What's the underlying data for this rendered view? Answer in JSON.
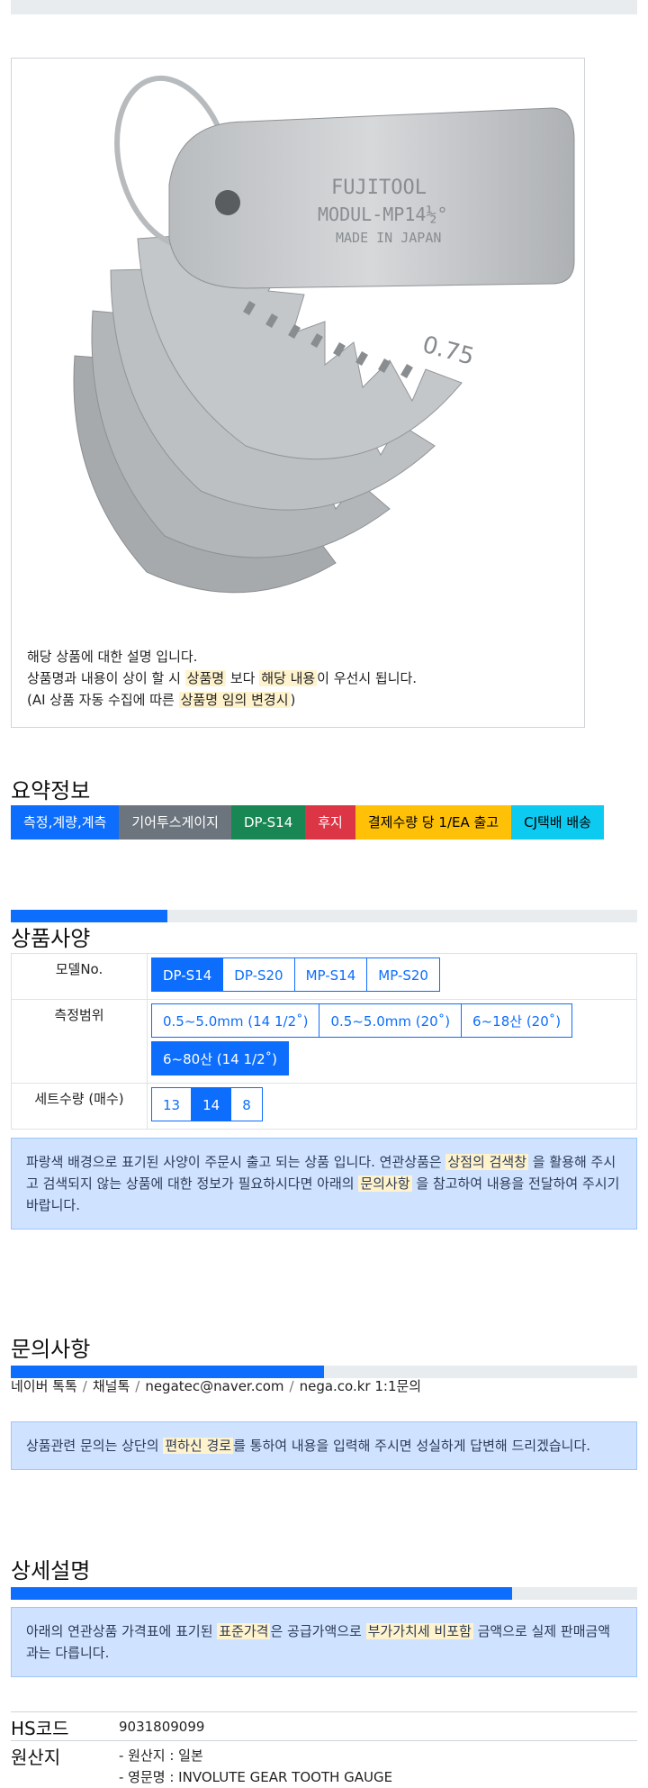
{
  "product": {
    "image_alt": "gear tooth gauge",
    "brand_mark": "FUJITOOL",
    "model_mark": "MODUL-MP14½°",
    "origin_mark": "MADE IN JAPAN",
    "leaf_mark": "0.75",
    "desc_line1": "해당 상품에 대한 설명 입니다.",
    "desc_line2_a": "상품명과 내용이 상이 할 시 ",
    "desc_line2_h1": "상품명",
    "desc_line2_b": " 보다 ",
    "desc_line2_h2": "해당 내용",
    "desc_line2_c": "이 우선시 됩니다.",
    "desc_line3_a": "(AI 상품 자동 수집에 따른 ",
    "desc_line3_h": "상품명 임의 변경시",
    "desc_line3_b": ")"
  },
  "summary": {
    "title": "요약정보",
    "badges": [
      {
        "label": "측정,계량,계측",
        "color": "#0d6efd",
        "text_color": "#ffffff"
      },
      {
        "label": "기어투스게이지",
        "color": "#6c757d",
        "text_color": "#ffffff"
      },
      {
        "label": "DP-S14",
        "color": "#198754",
        "text_color": "#ffffff"
      },
      {
        "label": "후지",
        "color": "#dc3545",
        "text_color": "#ffffff"
      },
      {
        "label": "결제수량 당 1/EA 출고",
        "color": "#ffc107",
        "text_color": "#000000"
      },
      {
        "label": "CJ택배 배송",
        "color": "#0dcaf0",
        "text_color": "#000000"
      }
    ]
  },
  "spec": {
    "title": "상품사양",
    "progress": 0.25,
    "rows": [
      {
        "label": "모델No.",
        "options": [
          "DP-S14",
          "DP-S20",
          "MP-S14",
          "MP-S20"
        ],
        "selected": 0
      },
      {
        "label": "측정범위",
        "options": [
          "0.5~5.0mm (14 1/2˚)",
          "0.5~5.0mm (20˚)",
          "6~18산 (20˚)",
          "6~80산 (14 1/2˚)"
        ],
        "selected": 3
      },
      {
        "label": "세트수량 (매수)",
        "options": [
          "13",
          "14",
          "8"
        ],
        "selected": 1
      }
    ],
    "notice_a": "파랑색 배경으로 표기된 사양이 주문시 출고 되는 상품 입니다. 연관상품은 ",
    "notice_h1": "상점의 검색창",
    "notice_b": " 을 활용해 주시고 검색되지 않는 상품에 대한 정보가 필요하시다면 아래의 ",
    "notice_h2": "문의사항",
    "notice_c": " 을 참고하여 내용을 전달하여 주시기 바랍니다."
  },
  "inquiry": {
    "title": "문의사항",
    "progress": 0.5,
    "links": [
      "네이버 톡톡",
      "채널톡",
      "negatec@naver.com",
      "nega.co.kr 1:1문의"
    ],
    "separator": "/",
    "notice_a": "상품관련 문의는 상단의 ",
    "notice_h": "편하신 경로",
    "notice_b": "를 통하여 내용을 입력해 주시면 성실하게 답변해 드리겠습니다."
  },
  "detail": {
    "title": "상세설명",
    "progress": 0.8,
    "notice_a": "아래의 연관상품 가격표에 표기된 ",
    "notice_h1": "표준가격",
    "notice_b": "은 공급가액으로 ",
    "notice_h2": "부가가치세 비포함",
    "notice_c": " 금액으로 실제 판매금액과는 다릅니다.",
    "hs_label": "HS코드",
    "hs_value": "9031809099",
    "origin_label": "원산지",
    "origin_line1": "- 원산지 : 일본",
    "origin_line2": "- 영문명 : INVOLUTE GEAR TOOTH GAUGE"
  }
}
